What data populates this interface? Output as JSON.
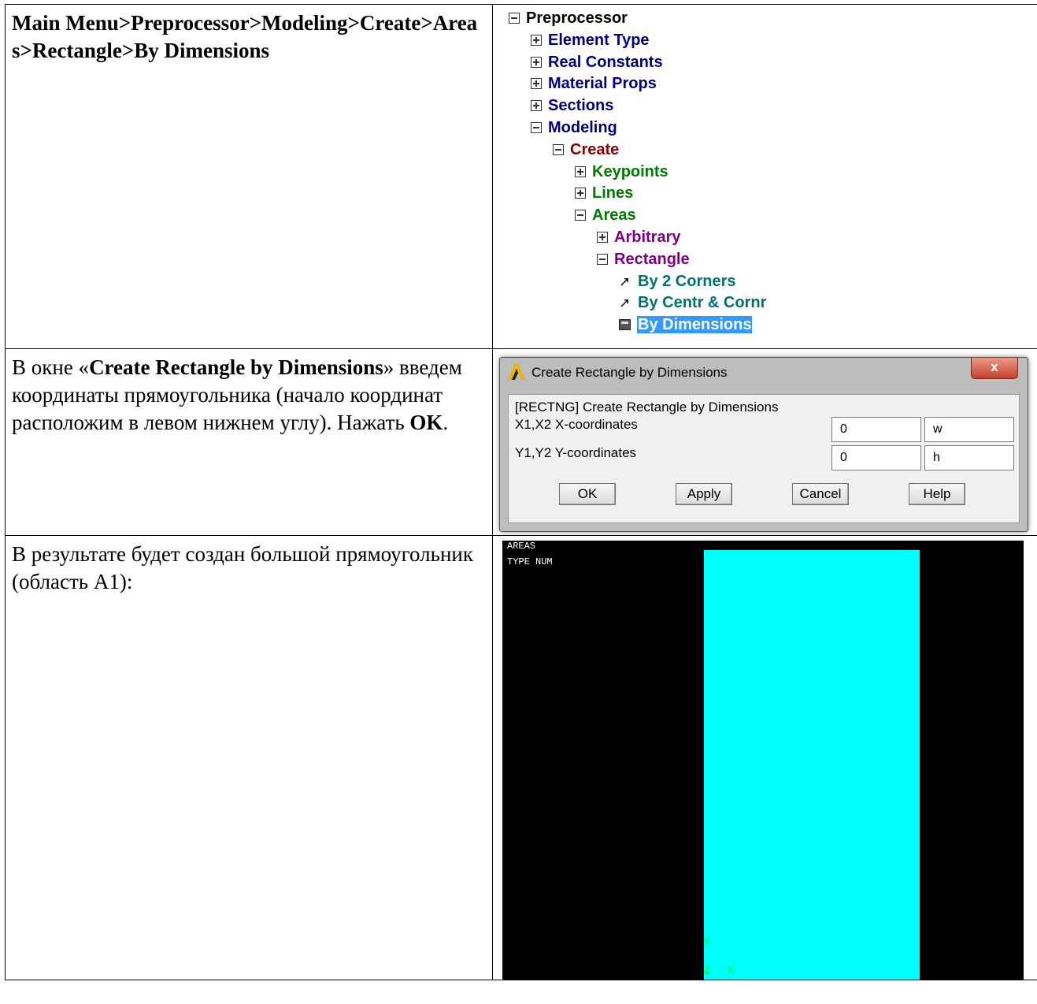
{
  "row1": {
    "path_text": "Main Menu>Preprocessor>Modeling>Create>Areas>Rectangle>By Dimensions",
    "tree": [
      {
        "label": "Preprocessor",
        "toggle": "minus",
        "color": "black"
      },
      {
        "label": "Element Type",
        "toggle": "plus",
        "color": "navy"
      },
      {
        "label": "Real Constants",
        "toggle": "plus",
        "color": "navy"
      },
      {
        "label": "Material Props",
        "toggle": "plus",
        "color": "navy"
      },
      {
        "label": "Sections",
        "toggle": "plus",
        "color": "navy"
      },
      {
        "label": "Modeling",
        "toggle": "minus",
        "color": "navy"
      },
      {
        "label": "Create",
        "toggle": "minus",
        "color": "dark-red"
      },
      {
        "label": "Keypoints",
        "toggle": "plus",
        "color": "green"
      },
      {
        "label": "Lines",
        "toggle": "plus",
        "color": "green"
      },
      {
        "label": "Areas",
        "toggle": "minus",
        "color": "green"
      },
      {
        "label": "Arbitrary",
        "toggle": "plus",
        "color": "purple"
      },
      {
        "label": "Rectangle",
        "toggle": "minus",
        "color": "purple"
      },
      {
        "label": "By 2 Corners",
        "icon": "pick-arrow-icon",
        "color": "teal"
      },
      {
        "label": "By Centr & Cornr",
        "icon": "pick-arrow-icon",
        "color": "teal"
      },
      {
        "label": "By Dimensions",
        "icon": "dialog-calculator-icon",
        "color": "teal",
        "selected": true
      }
    ]
  },
  "row2": {
    "text_prefix": "В окне «",
    "text_bold": "Create Rectangle by Dimensions",
    "text_mid": "» введем координаты прямоугольника (начало координат расположим в левом нижнем углу). Нажать ",
    "text_bold2": "OK",
    "text_end": ".",
    "dialog": {
      "title": "Create Rectangle by Dimensions",
      "close_symbol": "x",
      "header": "[RECTNG]  Create Rectangle by Dimensions",
      "x_label": "X1,X2  X-coordinates",
      "y_label": "Y1,Y2  Y-coordinates",
      "x1": "0",
      "x2": "w",
      "y1": "0",
      "y2": "h",
      "buttons": {
        "ok": "OK",
        "apply": "Apply",
        "cancel": "Cancel",
        "help": "Help"
      }
    }
  },
  "row3": {
    "text": "В результате будет создан большой прямоугольник (область A1):",
    "graphics": {
      "label1": "AREAS",
      "label2": "TYPE NUM",
      "axis_y": "Y",
      "axis_z": "Z",
      "axis_x": "X",
      "background": "#000000",
      "area_color": "#00ffff"
    }
  }
}
